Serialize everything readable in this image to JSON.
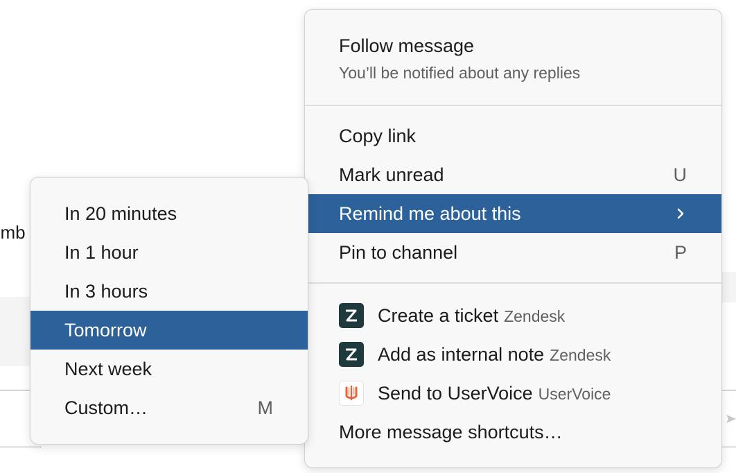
{
  "background": {
    "partial_text": "emb"
  },
  "main_menu": {
    "follow": {
      "title": "Follow message",
      "subtitle": "You’ll be notified about any replies"
    },
    "items": [
      {
        "label": "Copy link",
        "shortcut": ""
      },
      {
        "label": "Mark unread",
        "shortcut": "U"
      },
      {
        "label": "Remind me about this",
        "shortcut": "",
        "submenu": true,
        "highlighted": true
      },
      {
        "label": "Pin to channel",
        "shortcut": "P"
      }
    ],
    "app_items": [
      {
        "label": "Create a ticket",
        "app": "Zendesk",
        "icon": "zendesk-icon"
      },
      {
        "label": "Add as internal note",
        "app": "Zendesk",
        "icon": "zendesk-icon"
      },
      {
        "label": "Send to UserVoice",
        "app": "UserVoice",
        "icon": "uservoice-icon"
      }
    ],
    "more_shortcuts": "More message shortcuts…"
  },
  "remind_submenu": {
    "items": [
      {
        "label": "In 20 minutes",
        "shortcut": ""
      },
      {
        "label": "In 1 hour",
        "shortcut": ""
      },
      {
        "label": "In 3 hours",
        "shortcut": ""
      },
      {
        "label": "Tomorrow",
        "shortcut": "",
        "highlighted": true
      },
      {
        "label": "Next week",
        "shortcut": ""
      },
      {
        "label": "Custom…",
        "shortcut": "M"
      }
    ]
  },
  "colors": {
    "highlight": "#2c6199",
    "menu_bg": "#f8f8f8",
    "secondary_text": "#616061",
    "zendesk_bg": "#1f3a3d",
    "uservoice_accent": "#e8643a"
  }
}
